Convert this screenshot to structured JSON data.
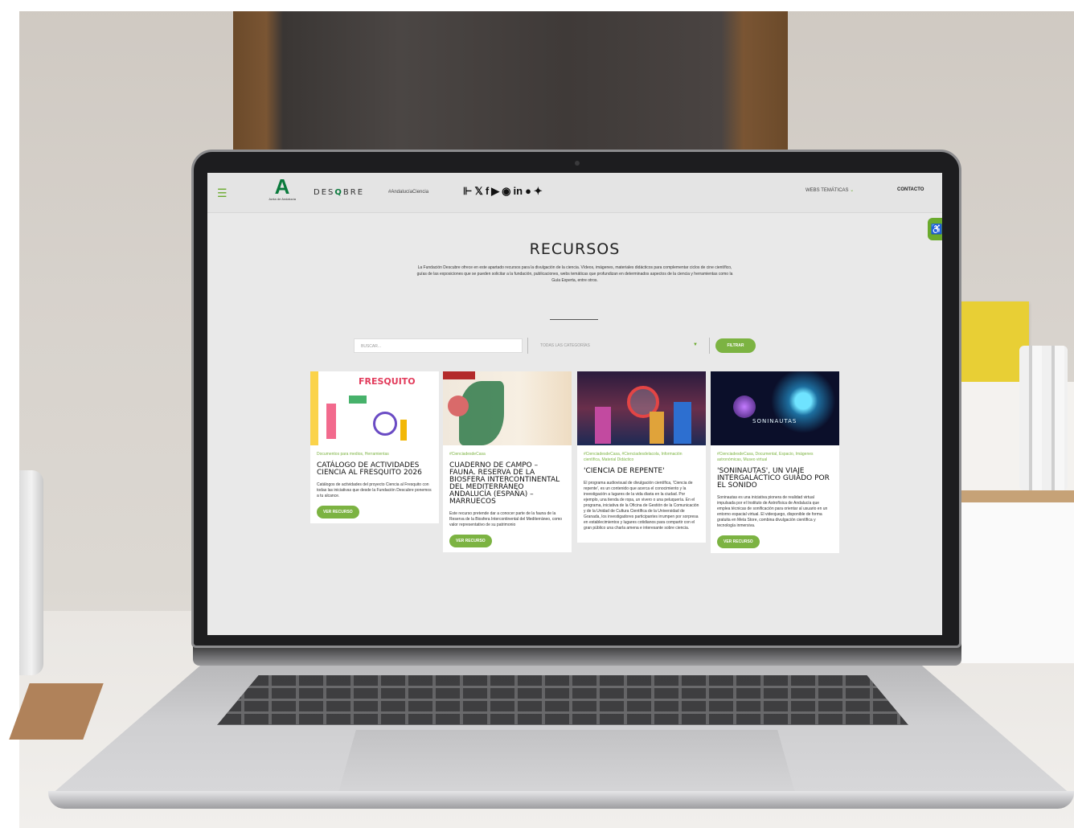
{
  "header": {
    "logo_letter": "A",
    "logo_text": "Junta de Andalucía",
    "brand": {
      "pre": "DES",
      "q": "Q",
      "post": "BRE"
    },
    "hashtag": "#AndalucíaCiencia",
    "social_icons": [
      "rss-icon",
      "x-icon",
      "facebook-icon",
      "youtube-icon",
      "instagram-icon",
      "linkedin-icon",
      "spotify-icon",
      "bluesky-icon"
    ],
    "webs_label": "WEBS TEMÁTICAS",
    "contact_label": "CONTACTO"
  },
  "page": {
    "title": "RECURSOS",
    "intro": "La Fundación Descubre ofrece en este apartado recursos para la divulgación de la ciencia. Vídeos, imágenes, materiales didácticos para complementar ciclos de cine científico, guías de las exposiciones que se pueden solicitar a la fundación, publicaciones, webs temáticas que profundizan en determinados aspectos de la ciencia y herramientas como la Guía Experta, entre otros."
  },
  "filters": {
    "search_placeholder": "BUSCAR...",
    "category_value": "TODAS LAS CATEGORÍAS",
    "filter_label": "FILTRAR"
  },
  "cards": [
    {
      "image_title": "FRESQUITO",
      "categories": "Documentos para medios, Herramientas",
      "title": "CATÁLOGO DE ACTIVIDADES CIENCIA AL FRESQUITO 2026",
      "desc": "Catálogos de actividades del proyecto Ciencia al Fresquito con todas las iniciativas que desde la Fundación Descubre ponemos a tu alcance.",
      "button": "VER RECURSO"
    },
    {
      "categories": "#CienciadesdeCasa",
      "title": "CUADERNO DE CAMPO – FAUNA. RESERVA DE LA BIOSFERA INTERCONTINENTAL DEL MEDITERRÁNEO ANDALUCÍA (ESPAÑA) – MARRUECOS",
      "desc": "Este recurso pretende dar a conocer parte de la fauna de la Reserva de la Biosfera Intercontinental del Mediterráneo, como valor representativo de su patrimonio",
      "button": "VER RECURSO"
    },
    {
      "categories": "#CienciadesdeCasa, #Cienciadesdelacola, Información científica, Material Didáctico",
      "title": "'CIENCIA DE REPENTE'",
      "desc": "El programa audiovisual de divulgación científica, 'Ciencia de repente', es un contenido que acerca el conocimiento y la investigación a lugares de la vida diaria en la ciudad. Por ejemplo, una tienda de ropa, un vivero o una peluquería. En el programa, iniciativa de la Oficina de Gestión de la Comunicación y de la Unidad de Cultura Científica de la Universidad de Granada, los investigadores participantes irrumpen por sorpresa en establecimientos y lugares cotidianos para compartir con el gran público una charla amena e interesante sobre ciencia.",
      "button": ""
    },
    {
      "image_title": "SONINAUTAS",
      "categories": "#CienciadesdeCasa, Documental, Espacio, Imágenes astronómicas, Museo virtual",
      "title": "'SONINAUTAS', UN VIAJE INTERGALÁCTICO GUIADO POR EL SONIDO",
      "desc": "Soninautas es una iniciativa pionera de realidad virtual impulsada por el Instituto de Astrofísica de Andalucía que emplea técnicas de sonificación para orientar al usuario en un entorno espacial virtual. El videojuego, disponible de forma gratuita en Meta Store, combina divulgación científica y tecnología inmersiva.",
      "button": "VER RECURSO"
    }
  ],
  "colors": {
    "accent_green": "#7cb342",
    "brand_green": "#0a7a3c"
  }
}
